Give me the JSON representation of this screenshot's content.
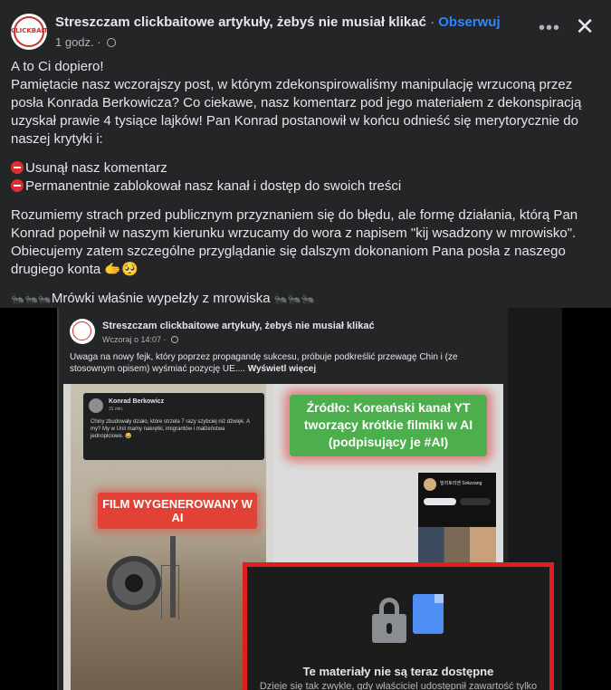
{
  "post": {
    "page_name": "Streszczam clickbaitowe artykuły, żebyś nie musiał klikać",
    "separator": "·",
    "follow_label": "Obserwuj",
    "time": "1 godz.",
    "more_label": "•••",
    "close_label": "✕",
    "avatar_text": "CLICKBAIT",
    "paragraphs": {
      "p1": "A to Ci dopiero!",
      "p2": "Pamiętacie nasz wczorajszy post, w którym zdekonspirowaliśmy manipulację wrzuconą przez posła Konrada Berkowicza? Co ciekawe, nasz komentarz pod jego materiałem z dekonspiracją uzyskał prawie 4 tysiące lajków! Pan Konrad postanowił w końcu odnieść się merytorycznie do naszej krytyki i:",
      "bullet1": "Usunął nasz komentarz",
      "bullet2": "Permanentnie zablokował nasz kanał i dostęp do swoich treści",
      "p3": "Rozumiemy strach przed publicznym przyznaniem się do błędu, ale formę działania, którą Pan Konrad popełnił w naszym kierunku wrzucamy do wora z napisem \"kij wsadzony w mrowisko\". Obiecujemy zatem szczególne przyglądanie się dalszym dokonaniom Pana posła z naszego drugiego konta 🫱🥺",
      "ants_left": "🐜🐜🐜",
      "p4": "Mrówki właśnie wypełzły z mrowiska",
      "ants_right": "🐜🐜🐜"
    }
  },
  "shared": {
    "page_name": "Streszczam clickbaitowe artykuły, żebyś nie musiał klikać",
    "time": "Wczoraj o 14:07 ·",
    "text": "Uwaga na nowy fejk, który poprzez propagandę sukcesu, próbuje podkreślić przewagę Chin i (ze stosownym opisem) wyśmiać pozycję UE....",
    "see_more": "Wyświetl więcej"
  },
  "collage": {
    "tweet_name": "Konrad Berkowicz",
    "tweet_time": "31 min. ·",
    "tweet_text": "Chiny zbudowały działo, które strzela 7 razy szybciej niż dźwięk. A my? My w Unii mamy nakrętki, imigrantów i małżeństwa jednopłciowe. 😂",
    "red_label": "FILM WYGENEROWANY W AI",
    "green_label": "Źródło: Koreański kanał YT tworzący krótkie filmiki w AI (podpisujący je #AI)",
    "yt_channel": "밀리토리엔 Sokzzang"
  },
  "unavailable": {
    "title": "Te materiały nie są teraz dostępne",
    "subtitle": "Dzieje się tak zwykle, gdy właściciel udostępnił zawartość tylko"
  }
}
